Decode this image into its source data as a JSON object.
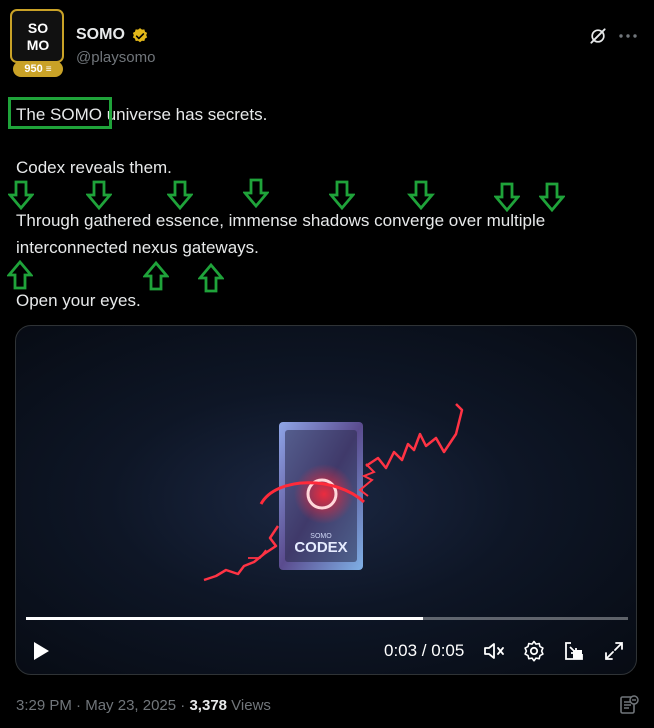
{
  "author": {
    "name": "SOMO",
    "handle": "@playsomo",
    "avatar_logo_text": "SOMO",
    "badge_count": "950",
    "verified_color": "#e2b719"
  },
  "tweet": {
    "line1_highlight": "The SOMO",
    "line1_rest": " universe has secrets.",
    "line2": "Codex reveals them.",
    "line3": "Through gathered essence, immense shadows converge over multiple interconnected nexus gateways.",
    "line4": "Open your eyes."
  },
  "annotations": {
    "box_color": "#1fa33a",
    "down_arrows": 8,
    "up_arrows": 3
  },
  "video": {
    "card_small_label": "SOMO",
    "card_title": "CODEX",
    "time_display": "0:03 / 0:05",
    "progress_fraction": 0.66
  },
  "footer": {
    "time": "3:29 PM",
    "sep1": " · ",
    "date": "May 23, 2025",
    "sep2": " · ",
    "views_count": "3,378",
    "views_label": " Views"
  },
  "icons": {
    "grok": "grok-icon",
    "more": "more-dots-icon",
    "play": "play-icon",
    "mute": "volume-muted-icon",
    "settings": "gear-icon",
    "dock": "dock-icon",
    "fullscreen": "fullscreen-icon",
    "analytics": "analytics-icon"
  }
}
